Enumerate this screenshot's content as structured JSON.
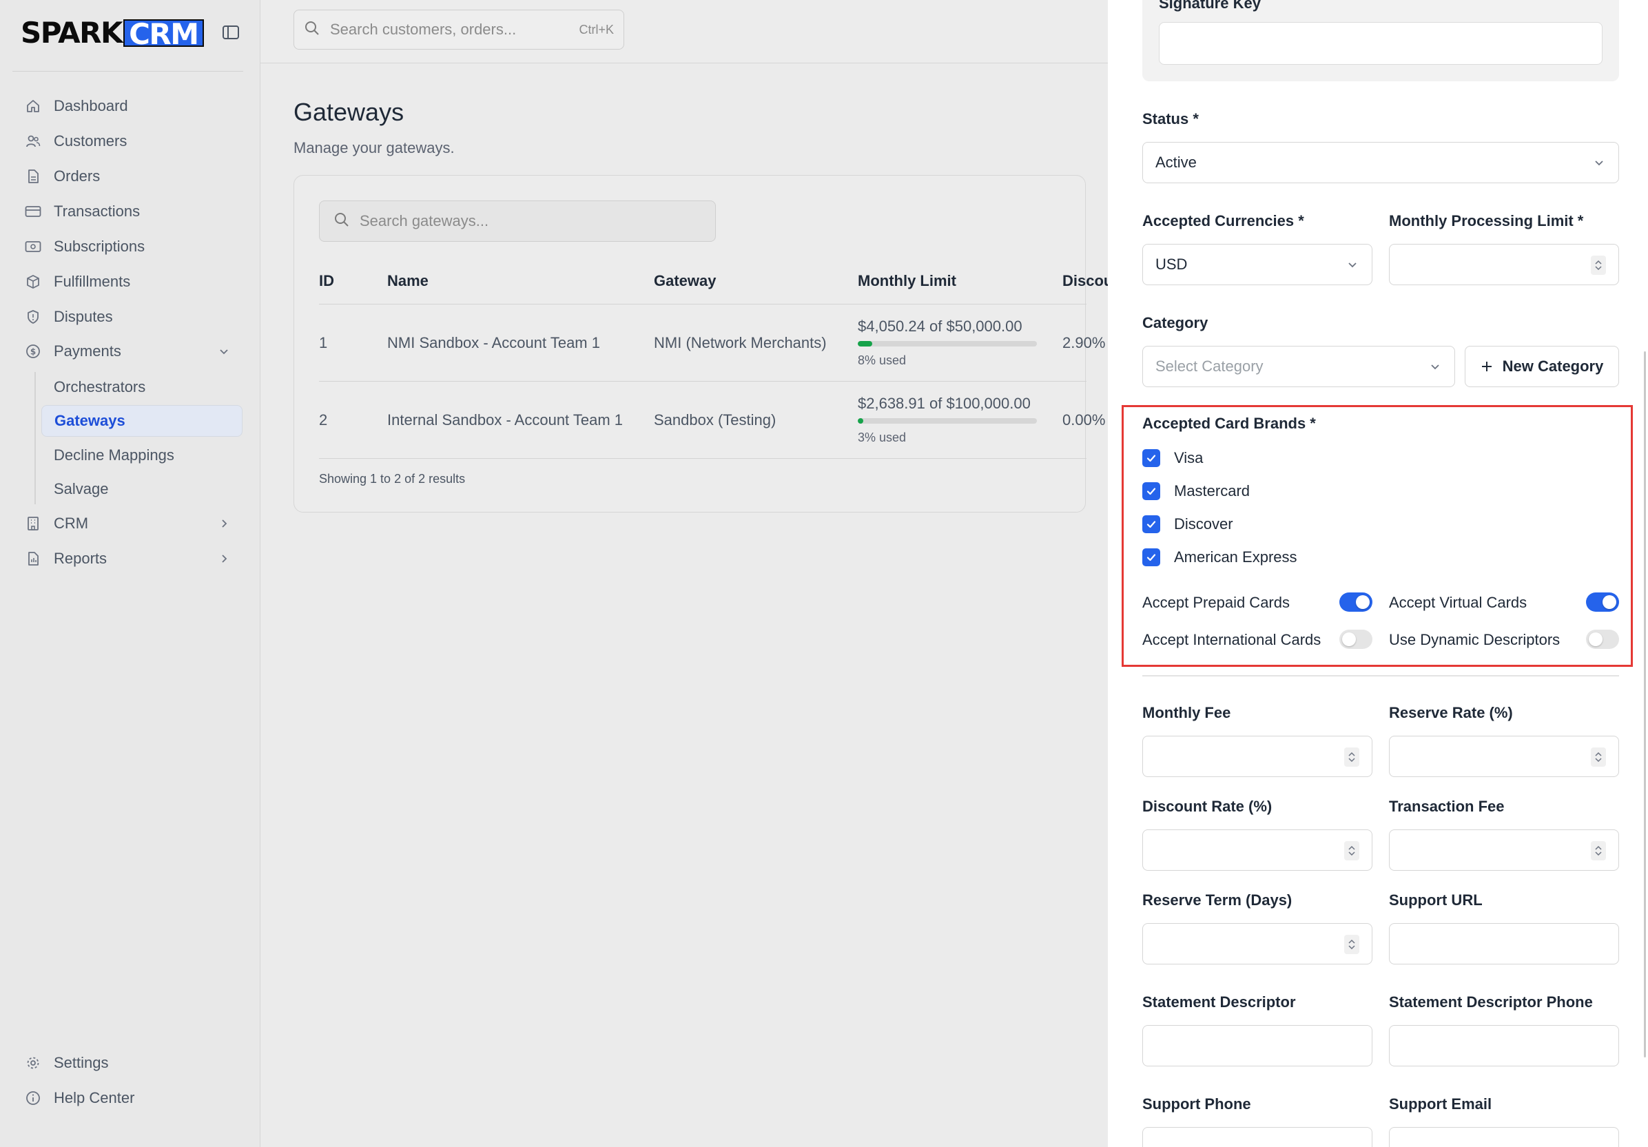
{
  "brand": {
    "word1": "SPARK",
    "word2": "CRM"
  },
  "header": {
    "search_placeholder": "Search customers, orders...",
    "search_shortcut": "Ctrl+K"
  },
  "sidebar": {
    "items": [
      {
        "label": "Dashboard",
        "icon": "home-icon"
      },
      {
        "label": "Customers",
        "icon": "users-icon"
      },
      {
        "label": "Orders",
        "icon": "document-icon"
      },
      {
        "label": "Transactions",
        "icon": "credit-card-icon"
      },
      {
        "label": "Subscriptions",
        "icon": "banknote-icon"
      },
      {
        "label": "Fulfillments",
        "icon": "package-icon"
      },
      {
        "label": "Disputes",
        "icon": "shield-icon"
      },
      {
        "label": "Payments",
        "icon": "dollar-circle-icon",
        "expanded": true
      },
      {
        "label": "CRM",
        "icon": "building-icon"
      },
      {
        "label": "Reports",
        "icon": "report-icon"
      }
    ],
    "payments_sub": [
      {
        "label": "Orchestrators"
      },
      {
        "label": "Gateways",
        "active": true
      },
      {
        "label": "Decline Mappings"
      },
      {
        "label": "Salvage"
      }
    ],
    "footer": [
      {
        "label": "Settings",
        "icon": "gear-icon"
      },
      {
        "label": "Help Center",
        "icon": "info-icon"
      }
    ]
  },
  "page": {
    "title": "Gateways",
    "subtitle": "Manage your gateways.",
    "search_placeholder": "Search gateways...",
    "columns": [
      "ID",
      "Name",
      "Gateway",
      "Monthly Limit",
      "Discou"
    ],
    "rows": [
      {
        "id": "1",
        "name": "NMI Sandbox - Account Team 1",
        "gateway": "NMI (Network Merchants)",
        "used_amount": "$4,050.24",
        "of": "of",
        "limit": "$50,000.00",
        "used_pct": 8,
        "used_label": "8% used",
        "discount": "2.90%"
      },
      {
        "id": "2",
        "name": "Internal Sandbox - Account Team 1",
        "gateway": "Sandbox (Testing)",
        "used_amount": "$2,638.91",
        "of": "of",
        "limit": "$100,000.00",
        "used_pct": 3,
        "used_label": "3% used",
        "discount": "0.00%"
      }
    ],
    "results_text": "Showing 1 to 2 of 2 results"
  },
  "drawer": {
    "signature_key_label": "Signature Key",
    "signature_key_value": "",
    "status_label": "Status *",
    "status_value": "Active",
    "currencies_label": "Accepted Currencies *",
    "currencies_value": "USD",
    "monthly_limit_label": "Monthly Processing Limit *",
    "monthly_limit_value": "",
    "category_label": "Category",
    "category_placeholder": "Select Category",
    "new_category_label": "New Category",
    "card_brands_label": "Accepted Card Brands *",
    "card_brands": [
      {
        "label": "Visa",
        "checked": true
      },
      {
        "label": "Mastercard",
        "checked": true
      },
      {
        "label": "Discover",
        "checked": true
      },
      {
        "label": "American Express",
        "checked": true
      }
    ],
    "toggles": [
      {
        "label": "Accept Prepaid Cards",
        "on": true
      },
      {
        "label": "Accept Virtual Cards",
        "on": true
      },
      {
        "label": "Accept International Cards",
        "on": false
      },
      {
        "label": "Use Dynamic Descriptors",
        "on": false
      }
    ],
    "fields": {
      "monthly_fee": "Monthly Fee",
      "reserve_rate": "Reserve Rate (%)",
      "discount_rate": "Discount Rate (%)",
      "transaction_fee": "Transaction Fee",
      "reserve_term": "Reserve Term (Days)",
      "support_url": "Support URL",
      "statement_descriptor": "Statement Descriptor",
      "statement_descriptor_phone": "Statement Descriptor Phone",
      "support_phone": "Support Phone",
      "support_email": "Support Email"
    }
  },
  "colors": {
    "accent": "#2563eb",
    "progress": "#16a34a",
    "highlight": "#e53935"
  }
}
